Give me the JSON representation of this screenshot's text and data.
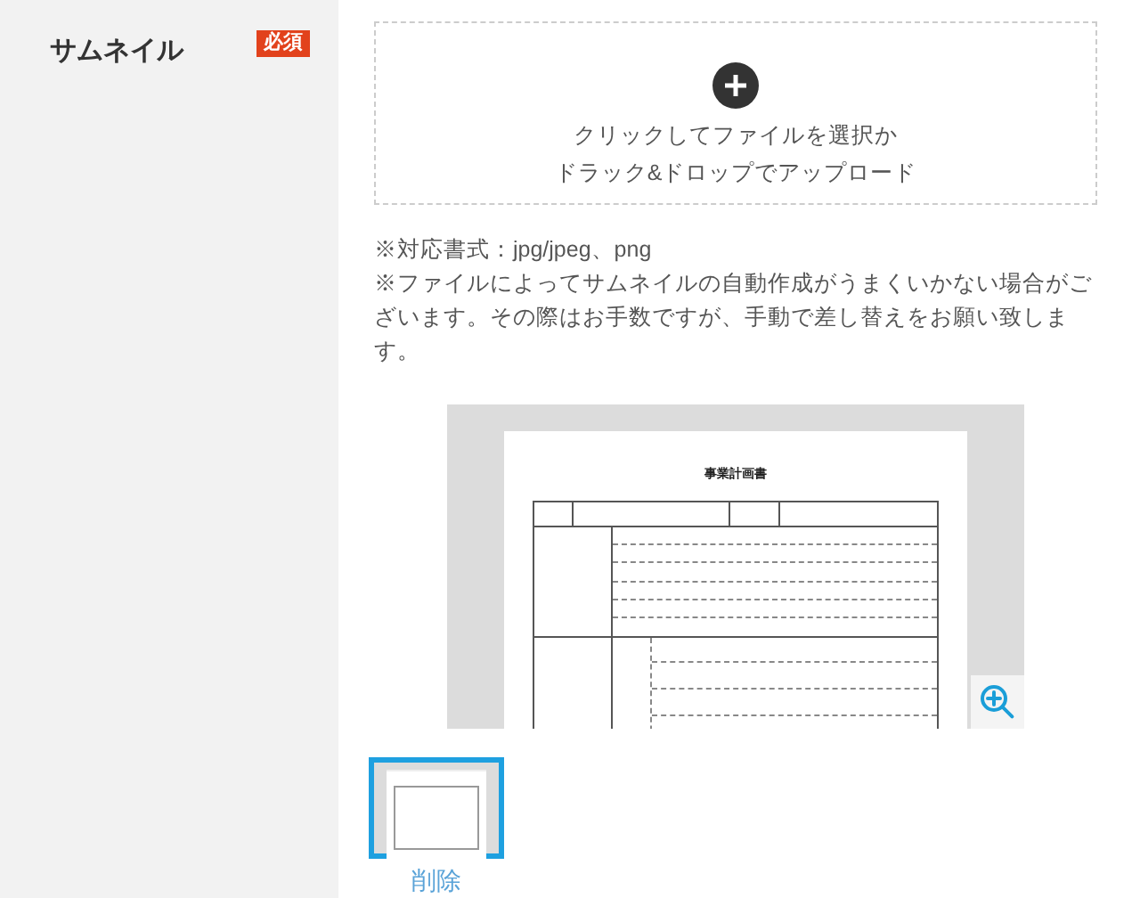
{
  "field": {
    "label": "サムネイル",
    "badge": "必須"
  },
  "dropzone": {
    "lines": [
      "クリックしてファイルを選択か",
      "ドラック&ドロップでアップロード"
    ]
  },
  "notes": [
    "※対応書式：jpg/jpeg、png",
    "※ファイルによってサムネイルの自動作成がうまくいかない場合がございます。その際はお手数ですが、手動で差し替えをお願い致します。"
  ],
  "preview": {
    "document_title": "事業計画書"
  },
  "thumbnails": [
    {
      "selected": true,
      "action": "削除"
    }
  ]
}
